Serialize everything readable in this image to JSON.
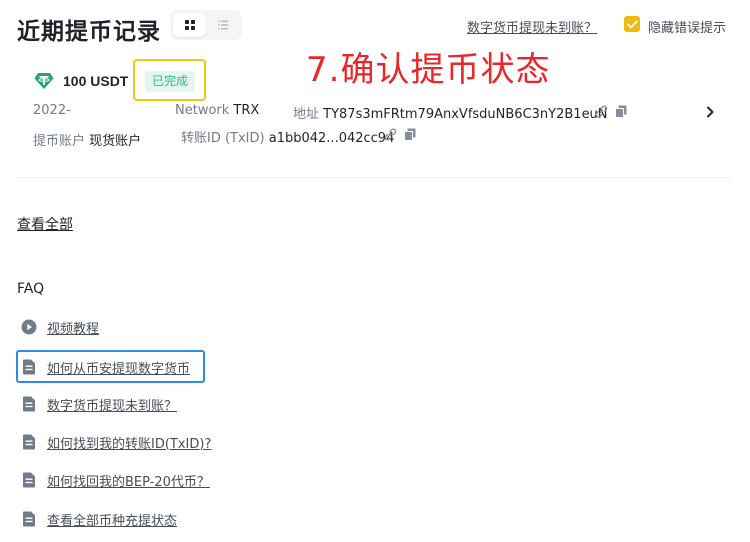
{
  "header": {
    "title": "近期提币记录",
    "grid_view_icon": "grid-icon",
    "list_view_icon": "list-icon",
    "not_arrived_link": "数字货币提现未到账？",
    "hide_errors_label": "隐藏错误提示",
    "hide_errors_checked": true
  },
  "annotation": {
    "text": "7.确认提币状态",
    "color": "#e8272a"
  },
  "record": {
    "coin_icon": "tether-icon",
    "amount": "100 USDT",
    "status": "已完成",
    "date": "2022-",
    "network_label": "Network",
    "network_value": "TRX",
    "address_label": "地址",
    "address_value": "TY87s3mFRtm79AnxVfsduNB6C3nY2B1euN",
    "account_label": "提币账户",
    "account_value": "现货账户",
    "txid_label": "转账ID (TxID)",
    "txid_value": "a1bb042...042cc94"
  },
  "view_all": "查看全部",
  "faq": {
    "title": "FAQ",
    "items": [
      {
        "label": "视频教程",
        "icon": "play-icon"
      },
      {
        "label": "如何从币安提现数字货币",
        "icon": "document-icon"
      },
      {
        "label": "数字货币提现未到账？",
        "icon": "document-icon"
      },
      {
        "label": "如何找到我的转账ID(TxID)?",
        "icon": "document-icon"
      },
      {
        "label": "如何找回我的BEP-20代币？",
        "icon": "document-icon"
      },
      {
        "label": "查看全部币种充提状态",
        "icon": "document-icon"
      }
    ]
  },
  "colors": {
    "accent": "#f0b90b",
    "success": "#2ebd85",
    "highlight_yellow": "#f5c518",
    "highlight_blue": "#2e8ce6",
    "tether": "#26a17b"
  }
}
